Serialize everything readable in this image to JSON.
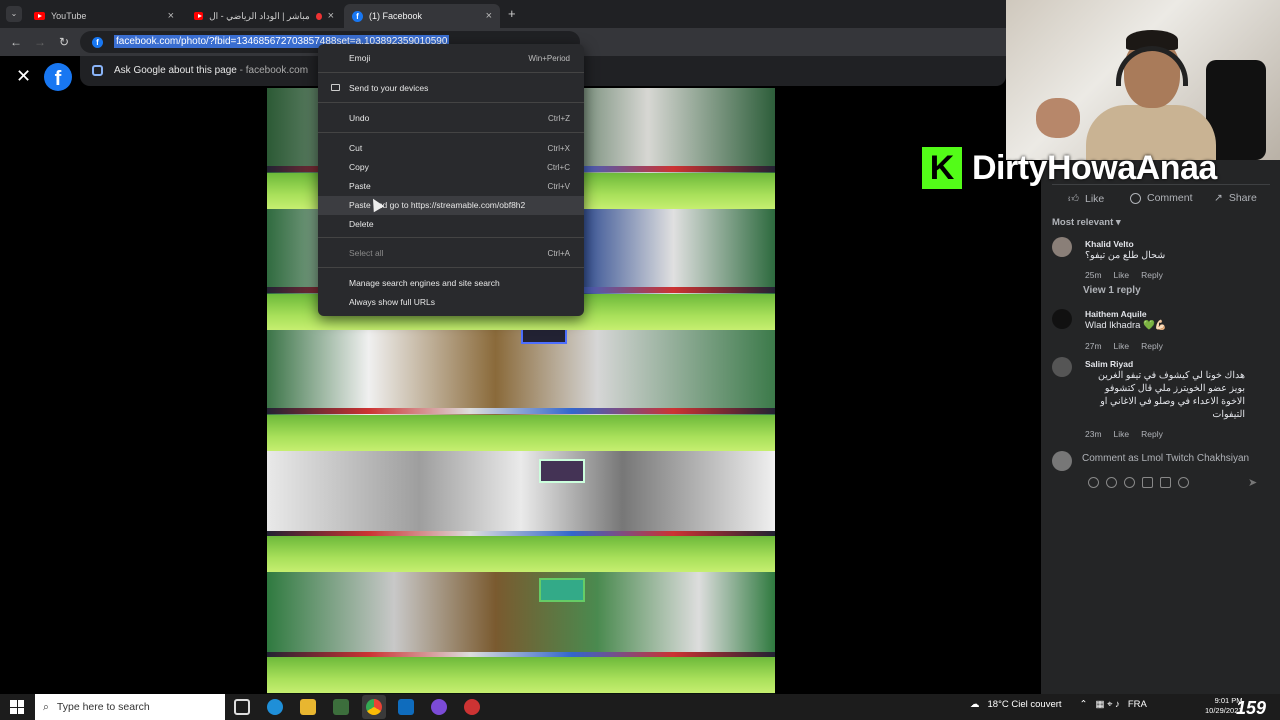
{
  "browser": {
    "tabs": [
      {
        "title": "YouTube",
        "favicon": "youtube-icon",
        "active": false
      },
      {
        "title": "بث مباشر | الوداد الرياضي - ال...",
        "favicon": "youtube-icon",
        "active": false
      },
      {
        "title": "(1) Facebook",
        "favicon": "facebook-icon",
        "active": true
      }
    ],
    "new_tab": "+",
    "url": "facebook.com/photo/?fbid=134685672703857488set=a.103892359010590",
    "ask_google": {
      "label": "Ask Google about this page",
      "suffix": "- facebook.com"
    }
  },
  "context_menu": {
    "items": [
      {
        "label": "Emoji",
        "shortcut": "Win+Period"
      },
      {
        "label": "Send to your devices",
        "shortcut": ""
      },
      {
        "label": "Undo",
        "shortcut": "Ctrl+Z"
      },
      {
        "label": "Cut",
        "shortcut": "Ctrl+X"
      },
      {
        "label": "Copy",
        "shortcut": "Ctrl+C"
      },
      {
        "label": "Paste",
        "shortcut": "Ctrl+V"
      },
      {
        "label": "Paste and go to https://streamable.com/obf8h2",
        "shortcut": ""
      },
      {
        "label": "Delete",
        "shortcut": ""
      },
      {
        "label": "Select all",
        "shortcut": "Ctrl+A"
      },
      {
        "label": "Manage search engines and site search",
        "shortcut": ""
      },
      {
        "label": "Always show full URLs",
        "shortcut": ""
      }
    ]
  },
  "overlay": {
    "brand_letter": "K",
    "brand_name": "DirtyHowaAnaa",
    "counter": "159"
  },
  "post": {
    "actions": {
      "like": "Like",
      "comment": "Comment",
      "share": "Share"
    },
    "sort_label": "Most relevant",
    "view_reply": "View 1 reply",
    "comment_placeholder": "Comment as Lmol Twitch Chakhsiyan"
  },
  "comments": [
    {
      "name": "Khalid Velto",
      "text": "شحال طلع من تيفو؟",
      "time": "25m",
      "like": "Like",
      "reply": "Reply"
    },
    {
      "name": "Haithem Aquile",
      "text": "Wlad lkhadra 💚💪🏻",
      "time": "27m",
      "like": "Like",
      "reply": "Reply"
    },
    {
      "name": "Salim Riyad",
      "text": "هداك خونا لي كيشوف في تيفو الغرين بويز عضو الخويترز ملي قال كتشوفو الاخوة الاعداء في وصلو في الاغاني او التيفوات",
      "time": "23m",
      "like": "Like",
      "reply": "Reply"
    }
  ],
  "taskbar": {
    "search_placeholder": "Type here to search",
    "weather": "18°C  Ciel couvert",
    "language": "FRA",
    "time": "9:01 PM",
    "date": "10/29/2023"
  },
  "colors": {
    "facebook_blue": "#1877f2",
    "kick_green": "#53fc18",
    "url_highlight": "#3a6ed1"
  }
}
